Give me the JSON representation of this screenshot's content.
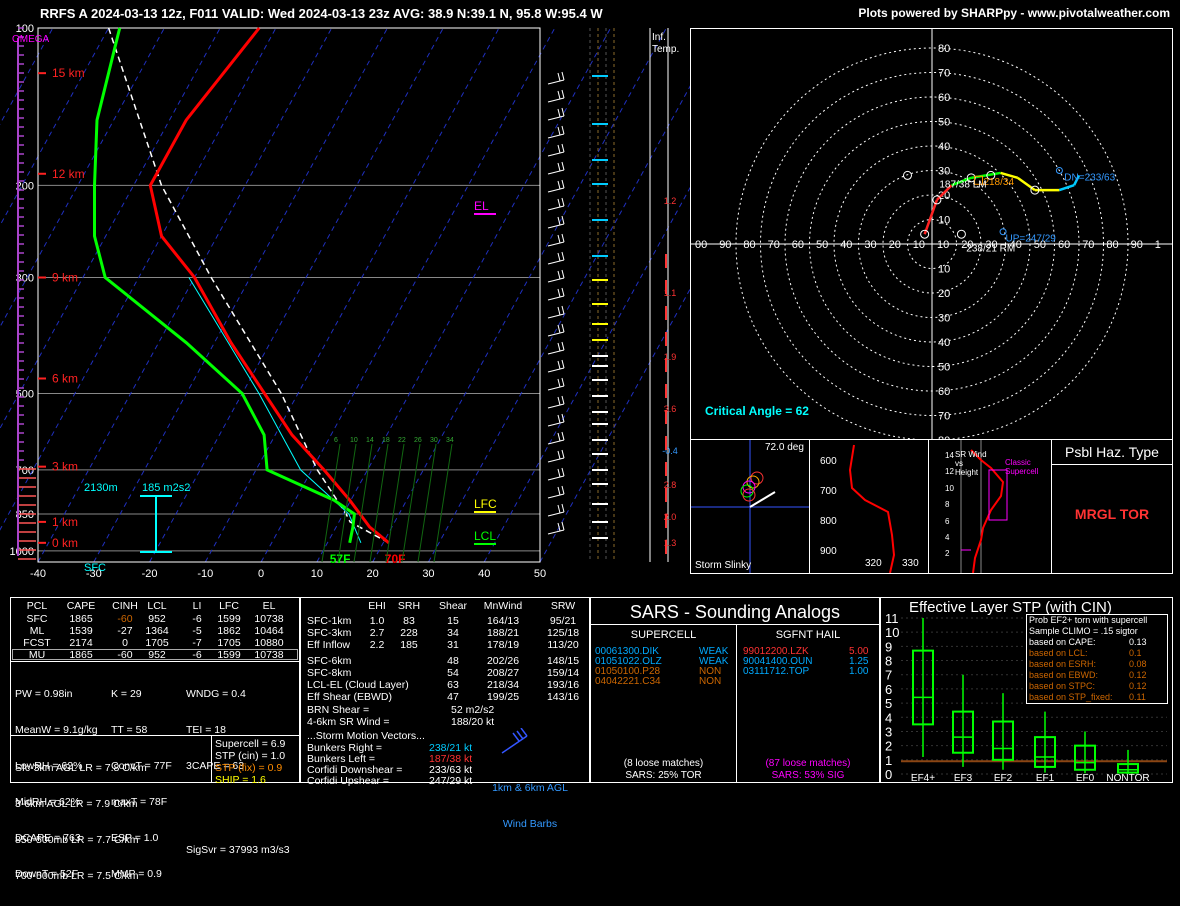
{
  "header": {
    "title": "RRFS A 2024-03-13 12z, F011  VALID: Wed 2024-03-13 23z  AVG: 38.9 N:39.1 N, 95.8 W:95.4 W",
    "credit": "Plots powered by SHARPpy - www.pivotalweather.com"
  },
  "colors": {
    "temperature": "#ff0000",
    "dewpoint": "#00ff00",
    "parcel": "#ffffff",
    "wetbulb": "#00ffff",
    "height": "#ff2222",
    "accent": "#00ccff",
    "omega": "#ff00ff"
  },
  "chart_data": [
    {
      "type": "line",
      "name": "skewt",
      "title": "",
      "xlabel": "",
      "ylabel": "",
      "pressure_ticks": [
        100,
        200,
        300,
        500,
        700,
        850,
        1000
      ],
      "temperature_ticks": [
        -40,
        -30,
        -20,
        -10,
        0,
        10,
        20,
        30,
        40,
        50
      ],
      "xlim": [
        -40,
        50
      ],
      "ylim": [
        1000,
        100
      ],
      "yscale": "log",
      "height_labels": [
        {
          "label": "15 km",
          "p": 122
        },
        {
          "label": "12 km",
          "p": 190
        },
        {
          "label": "9 km",
          "p": 300
        },
        {
          "label": "6 km",
          "p": 468
        },
        {
          "label": "3 km",
          "p": 690
        },
        {
          "label": "1 km",
          "p": 880
        },
        {
          "label": "0 km",
          "p": 965
        }
      ],
      "series": [
        {
          "name": "temperature",
          "p": [
            965,
            900,
            850,
            800,
            700,
            600,
            500,
            400,
            300,
            250,
            200,
            150,
            100
          ],
          "t": [
            21,
            16,
            13,
            9.8,
            2.2,
            -7,
            -16,
            -27,
            -40,
            -50,
            -57,
            -57,
            -53
          ]
        },
        {
          "name": "dewpoint",
          "p": [
            965,
            900,
            850,
            800,
            700,
            600,
            500,
            400,
            300,
            250,
            200,
            150,
            100
          ],
          "t": [
            14,
            13,
            12,
            7,
            -8,
            -12,
            -20,
            -35,
            -56,
            -62,
            -67,
            -73,
            -78
          ]
        }
      ],
      "labels": {
        "sfc_temp": "70F",
        "sfc_dew": "57F",
        "lfc": "LFC",
        "lcl": "LCL",
        "el": "EL",
        "omega": "OMEGA",
        "sfc": "SFC",
        "inflow_base": "2130m",
        "inflow_srh": "185 m2s2"
      }
    },
    {
      "type": "line",
      "name": "hodograph",
      "rings": [
        10,
        20,
        30,
        40,
        50,
        60,
        70,
        80
      ],
      "ring_axis_labels": [
        "80",
        "70",
        "60",
        "50",
        "40",
        "30",
        "20",
        "10",
        "10",
        "20",
        "30",
        "40",
        "50",
        "60",
        "70",
        "80"
      ],
      "x_axis_labels": [
        "00",
        "90",
        "80",
        "70",
        "60",
        "50",
        "40",
        "30",
        "20",
        "10",
        "10",
        "20",
        "30",
        "40",
        "50",
        "60",
        "70",
        "80",
        "90",
        "1"
      ],
      "u": [
        -3,
        2,
        8,
        16,
        22,
        28,
        35,
        42,
        52,
        58,
        60
      ],
      "v": [
        4,
        18,
        24,
        27,
        28,
        29,
        27,
        22,
        22,
        24,
        28
      ],
      "annotations": {
        "lm": "187/38 LM",
        "rm": "238/21 RM",
        "dn": "DN=233/63",
        "up": "UP=247/29",
        "mean": "218/34",
        "critical_angle": "Critical Angle = 62"
      }
    }
  ],
  "inferred_temp_label": "Inf.\nTemp.",
  "omega_values": [
    "1.2",
    "1.1",
    "1.9",
    "3.6",
    "-0.4",
    "2.8",
    "2.0",
    "1.3"
  ],
  "wind_speed_labels": [
    "6",
    "10",
    "14",
    "18",
    "22",
    "26",
    "30",
    "34"
  ],
  "slinky": {
    "label": "Storm Slinky",
    "deg": "72.0 deg"
  },
  "theta": {
    "ticks": [
      "600",
      "700",
      "800",
      "900"
    ],
    "bottom": [
      "320",
      "330"
    ]
  },
  "srwind": {
    "title": "SR Wind",
    "vs": "vs",
    "height": "Height",
    "classic": "Classic",
    "supercell": "Supercell",
    "ticks": [
      "14",
      "12",
      "10",
      "8",
      "6",
      "4",
      "2"
    ]
  },
  "psbl": {
    "title": "Psbl Haz. Type",
    "value": "MRGL TOR"
  },
  "parcels": {
    "headers": [
      "PCL",
      "CAPE",
      "CINH",
      "LCL",
      "LI",
      "LFC",
      "EL"
    ],
    "rows": [
      [
        "SFC",
        "1865",
        "-60",
        "952",
        "-6",
        "1599",
        "10738"
      ],
      [
        "ML",
        "1539",
        "-27",
        "1364",
        "-5",
        "1862",
        "10464"
      ],
      [
        "FCST",
        "2174",
        "0",
        "1705",
        "-7",
        "1705",
        "10880"
      ],
      [
        "MU",
        "1865",
        "-60",
        "952",
        "-6",
        "1599",
        "10738"
      ]
    ]
  },
  "indices": {
    "col1": [
      "PW = 0.98in",
      "MeanW = 9.1g/kg",
      "LowRH = 62%",
      "MidRH = 62%",
      "DCAPE = 763",
      "DownT = 52F"
    ],
    "col2": [
      "K = 29",
      "TT = 58",
      "ConvT = 77F",
      "maxT = 78F",
      "ESP = 1.0",
      "MMP = 0.9"
    ],
    "col3": [
      "WNDG = 0.4",
      "TEI = 18",
      "3CAPE = 63",
      "",
      "",
      "SigSvr = 37993 m3/s3"
    ]
  },
  "lapse": [
    "Sfc-3km AGL LR = 7.8 C/km",
    "3-6km AGL LR = 7.9 C/km",
    "850-500mb LR = 7.7 C/km",
    "700-500mb LR = 7.5 C/km"
  ],
  "params": [
    {
      "text": "Supercell = 6.9",
      "color": "#ffffff"
    },
    {
      "text": "STP (cin) = 1.0",
      "color": "#ffffff"
    },
    {
      "text": "STP (fix) = 0.9",
      "color": "#ff8c00"
    },
    {
      "text": "SHIP = 1.6",
      "color": "#ffff00"
    }
  ],
  "kinematics": {
    "headers": [
      "EHI",
      "SRH",
      "Shear",
      "MnWind",
      "SRW"
    ],
    "rows": [
      [
        "SFC-1km",
        "1.0",
        "83",
        "15",
        "164/13",
        "95/21"
      ],
      [
        "SFC-3km",
        "2.7",
        "228",
        "34",
        "188/21",
        "125/18"
      ],
      [
        "Eff Inflow",
        "2.2",
        "185",
        "31",
        "178/19",
        "113/20"
      ],
      [
        "SFC-6km",
        "",
        "",
        "48",
        "202/26",
        "148/15"
      ],
      [
        "SFC-8km",
        "",
        "",
        "54",
        "208/27",
        "159/14"
      ],
      [
        "LCL-EL (Cloud Layer)",
        "",
        "",
        "63",
        "218/34",
        "193/16"
      ],
      [
        "Eff Shear (EBWD)",
        "",
        "",
        "47",
        "199/25",
        "143/16"
      ]
    ],
    "brn": "BRN Shear =",
    "brn_val": "52 m2/s2",
    "srw46": "4-6km SR Wind =",
    "srw46_val": "188/20 kt",
    "motion_title": "...Storm Motion Vectors...",
    "motion": [
      {
        "label": "Bunkers Right =",
        "value": "238/21 kt",
        "color": "#00ccff"
      },
      {
        "label": "Bunkers Left =",
        "value": "187/38 kt",
        "color": "#ff3333"
      },
      {
        "label": "Corfidi Downshear =",
        "value": "233/63 kt",
        "color": "#ffffff"
      },
      {
        "label": "Corfidi Upshear =",
        "value": "247/29 kt",
        "color": "#ffffff"
      }
    ],
    "barb_note1": "1km & 6km AGL",
    "barb_note2": "Wind Barbs"
  },
  "sars": {
    "title": "SARS - Sounding Analogs",
    "supercell_title": "SUPERCELL",
    "hail_title": "SGFNT HAIL",
    "supercell": [
      {
        "id": "00061300.DIK",
        "v": "WEAK",
        "c": "#00aaff"
      },
      {
        "id": "01051022.OLZ",
        "v": "WEAK",
        "c": "#00aaff"
      },
      {
        "id": "01050100.P28",
        "v": "NON",
        "c": "#cc6600"
      },
      {
        "id": "04042221.C34",
        "v": "NON",
        "c": "#cc6600"
      }
    ],
    "hail": [
      {
        "id": "99012200.LZK",
        "v": "5.00",
        "c": "#ff3333"
      },
      {
        "id": "90041400.OUN",
        "v": "1.25",
        "c": "#00aaff"
      },
      {
        "id": "03111712.TOP",
        "v": "1.00",
        "c": "#00aaff"
      }
    ],
    "loose1": "(8 loose matches)",
    "pct1": "SARS: 25% TOR",
    "loose2": "(87 loose matches)",
    "pct2": "SARS: 53% SIG"
  },
  "stp": {
    "title": "Effective Layer STP (with CIN)",
    "yticks": [
      "0",
      "1",
      "2",
      "3",
      "4",
      "5",
      "6",
      "7",
      "8",
      "9",
      "10",
      "11"
    ],
    "categories": [
      "EF4+",
      "EF3",
      "EF2",
      "EF1",
      "EF0",
      "NONTOR"
    ],
    "boxes": [
      {
        "lo": 1.2,
        "q1": 3.5,
        "med": 5.4,
        "q3": 8.7,
        "hi": 11
      },
      {
        "lo": 0.5,
        "q1": 1.5,
        "med": 2.6,
        "q3": 4.4,
        "hi": 7
      },
      {
        "lo": 0.3,
        "q1": 1.0,
        "med": 1.8,
        "q3": 3.7,
        "hi": 5.7
      },
      {
        "lo": 0.1,
        "q1": 0.5,
        "med": 1.2,
        "q3": 2.6,
        "hi": 4.4
      },
      {
        "lo": 0.05,
        "q1": 0.3,
        "med": 0.8,
        "q3": 2.0,
        "hi": 3.0
      },
      {
        "lo": 0.0,
        "q1": 0.1,
        "med": 0.3,
        "q3": 0.7,
        "hi": 1.7
      }
    ],
    "current": 0.9,
    "prob_title": "Prob EF2+ torn with supercell",
    "prob_sub": "Sample CLIMO = .15 sigtor",
    "prob_rows": [
      {
        "label": "based on CAPE:",
        "value": "0.13",
        "c": "#ffffff"
      },
      {
        "label": "based on LCL:",
        "value": "0.1",
        "c": "#cc6600"
      },
      {
        "label": "based on ESRH:",
        "value": "0.08",
        "c": "#cc6600"
      },
      {
        "label": "based on EBWD:",
        "value": "0.12",
        "c": "#cc6600"
      },
      {
        "label": "based on STPC:",
        "value": "0.12",
        "c": "#cc6600"
      },
      {
        "label": "based on STP_fixed:",
        "value": "0.11",
        "c": "#cc6600"
      }
    ]
  }
}
